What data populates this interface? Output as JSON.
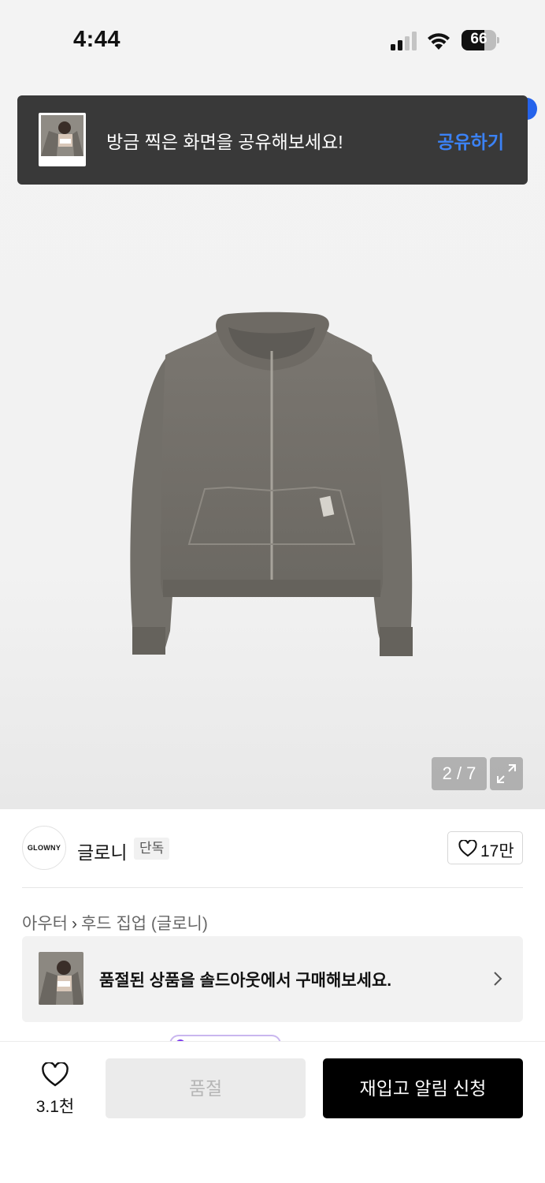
{
  "status_bar": {
    "time": "4:44",
    "battery": "66",
    "battery_level": 0.66,
    "icons": [
      "signal-icon",
      "wifi-icon",
      "battery-icon"
    ]
  },
  "share_toast": {
    "message": "방금 찍은 화면을 공유해보세요!",
    "action": "공유하기",
    "action_color": "#3b82f6"
  },
  "gallery": {
    "indicator": "2 / 7",
    "expand_icon": "expand-icon"
  },
  "brand": {
    "logo_text": "GLOWNY",
    "name": "글로니",
    "badge": "단독",
    "likes": "17만"
  },
  "breadcrumb": {
    "category": "아우터",
    "subcategory": "후드 집업 (글로니)"
  },
  "soldout_banner": {
    "text": "품절된 상품을 솔드아웃에서 구매해보세요."
  },
  "bottom_bar": {
    "wish_count": "3.1천",
    "soldout_label": "품절",
    "restock_label": "재입고 알림 신청"
  },
  "colors": {
    "primary_button": "#000000",
    "disabled_button": "#ebebeb",
    "toast_bg": "#393939"
  }
}
